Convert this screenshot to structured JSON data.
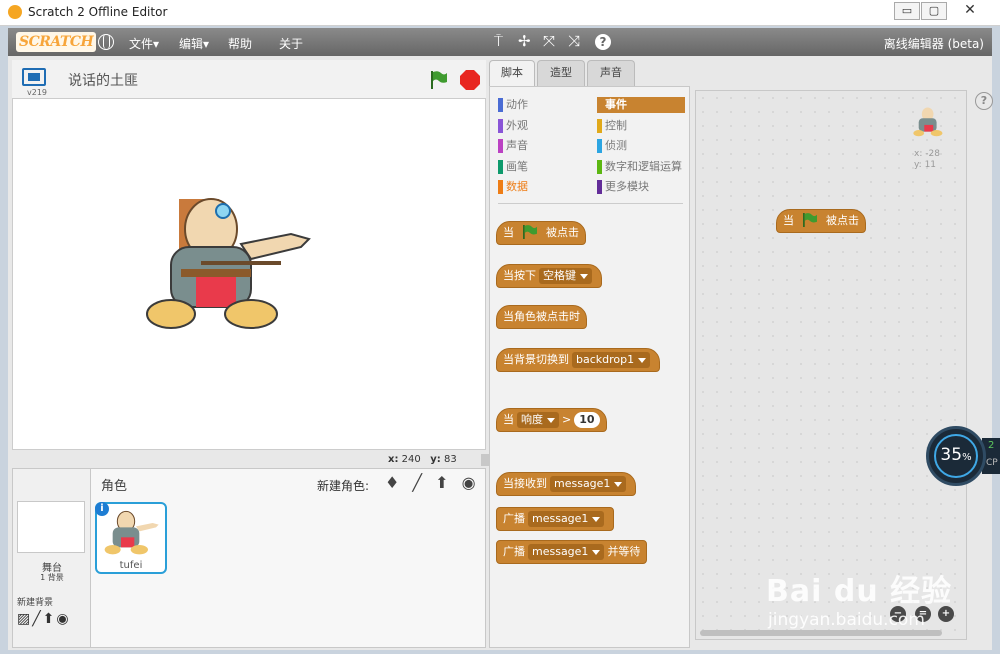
{
  "window": {
    "title": "Scratch 2 Offline Editor",
    "minimize": "▭",
    "maximize": "▢",
    "close": "✕"
  },
  "menubar": {
    "logo": "SCRATCH",
    "globe_icon": "globe-icon",
    "items": [
      "文件▾",
      "编辑▾",
      "帮助",
      "关于"
    ],
    "tools": [
      "stamp-icon",
      "cut-icon",
      "grow-icon",
      "shrink-icon",
      "help-icon"
    ],
    "tool_glyphs": [
      "⍑",
      "✢",
      "⤧",
      "⤨",
      "?"
    ],
    "edition": "离线编辑器 (beta)"
  },
  "stage": {
    "version": "v219",
    "project_title": "说话的土匪",
    "coords_x_label": "x:",
    "coords_x": "240",
    "coords_y_label": "y:",
    "coords_y": "83"
  },
  "sprites_pane": {
    "title": "角色",
    "new_sprite_label": "新建角色:",
    "new_sprite_tools": "♦ ╱ ⬆ ◉",
    "stage_label": "舞台",
    "stage_sub": "1 背景",
    "new_backdrop_label": "新建背景",
    "new_backdrop_tools": "▨╱⬆◉",
    "sprite": {
      "name": "tufei",
      "info": "i"
    }
  },
  "tabs": [
    "脚本",
    "造型",
    "声音"
  ],
  "categories": [
    {
      "label": "动作",
      "color": "#4a6cd4"
    },
    {
      "label": "外观",
      "color": "#8a55d7"
    },
    {
      "label": "声音",
      "color": "#bb42c3"
    },
    {
      "label": "画笔",
      "color": "#0e9a6c"
    },
    {
      "label": "数据",
      "color": "#ee7d16"
    },
    {
      "label": "事件",
      "color": "#c88330"
    },
    {
      "label": "控制",
      "color": "#e1a91a"
    },
    {
      "label": "侦测",
      "color": "#2ca5e2"
    },
    {
      "label": "数字和逻辑运算",
      "color": "#5cb712"
    },
    {
      "label": "更多模块",
      "color": "#632d99"
    }
  ],
  "blocks": {
    "when_flag_pre": "当",
    "when_flag_post": "被点击",
    "when_key": "当按下",
    "key_value": "空格键",
    "when_sprite_clicked": "当角色被点击时",
    "when_backdrop": "当背景切换到",
    "backdrop_value": "backdrop1",
    "when_pre": "当",
    "loudness": "响度",
    "gt": ">",
    "loudness_value": "10",
    "when_receive": "当接收到",
    "message_value": "message1",
    "broadcast": "广播",
    "broadcast_wait": "并等待"
  },
  "scripts_area": {
    "help": "?",
    "sprite_x": "x: -28",
    "sprite_y": "y: 11",
    "zoom": [
      "−",
      "=",
      "+"
    ],
    "script_block_pre": "当",
    "script_block_post": "被点击"
  },
  "overlay": {
    "cpu_percent": "35",
    "percent_sign": "%",
    "side_value": "2",
    "side_label": "CP"
  },
  "watermark": {
    "logo": "Bai du 经验",
    "url": "jingyan.baidu.com"
  },
  "colors": {
    "events": "#c88330",
    "selected_sprite_border": "#2a9fd8",
    "stop": "#e8251f",
    "flag": "#3f9b2f"
  }
}
